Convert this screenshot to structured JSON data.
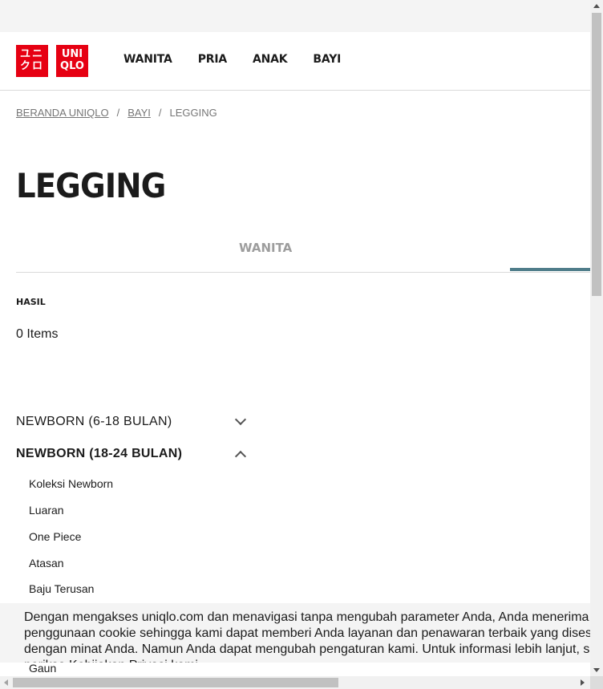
{
  "header": {
    "logo_left": [
      "ユニ",
      "クロ"
    ],
    "logo_right": [
      "UNI",
      "QLO"
    ],
    "nav": [
      "WANITA",
      "PRIA",
      "ANAK",
      "BAYI"
    ]
  },
  "breadcrumb": {
    "home": "BERANDA UNIQLO",
    "sep": "/",
    "category": "BAYI",
    "current": "LEGGING"
  },
  "page_title": "LEGGING",
  "tabs": {
    "wanita": "WANITA"
  },
  "results": {
    "label": "HASIL",
    "count": "0 Items"
  },
  "accordion": {
    "section1": "NEWBORN (6-18 BULAN)",
    "section2": "NEWBORN (18-24 BULAN)",
    "items": [
      "Koleksi Newborn",
      "Luaran",
      "One Piece",
      "Atasan",
      "Baju Terusan",
      "Gaun"
    ]
  },
  "cookie": {
    "text": "Dengan mengakses uniqlo.com dan menavigasi tanpa mengubah parameter Anda, Anda menerima penggunaan cookie sehingga kami dapat memberi Anda layanan dan penawaran terbaik yang disesuaikan dengan minat Anda. Namun Anda dapat mengubah pengaturan kami. Untuk informasi lebih lanjut, silakan periksa Kebijakan Privasi kami."
  },
  "colors": {
    "brand": "#e60012",
    "tab_indicator": "#4f7d8a"
  }
}
